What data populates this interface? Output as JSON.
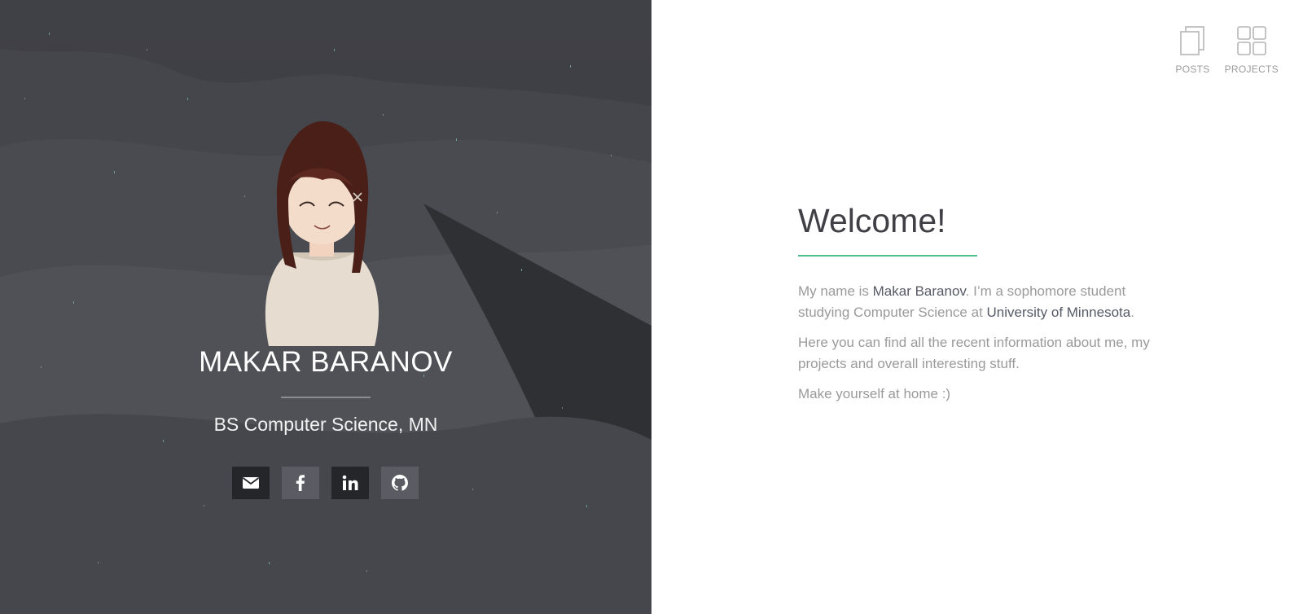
{
  "profile": {
    "name": "MAKAR BARANOV",
    "subtitle": "BS Computer Science, MN",
    "avatar_icon": "avatar-illustration"
  },
  "socials": [
    {
      "name": "email",
      "icon": "envelope-icon"
    },
    {
      "name": "facebook",
      "icon": "facebook-icon"
    },
    {
      "name": "linkedin",
      "icon": "linkedin-icon"
    },
    {
      "name": "github",
      "icon": "github-icon"
    }
  ],
  "nav": {
    "posts_label": "POSTS",
    "projects_label": "PROJECTS"
  },
  "welcome": {
    "title": "Welcome!",
    "p1_before": "My name is ",
    "p1_name": "Makar Baranov",
    "p1_mid": ". I’m a sophomore student studying Computer Science at ",
    "p1_link": "University of Minnesota",
    "p1_after": ".",
    "p2": "Here you can find all the recent information about me, my projects and overall interesting stuff.",
    "p3": "Make yourself at home :)"
  },
  "colors": {
    "accent": "#4fc08d",
    "hero_bg": "#3d3e44",
    "muted_text": "#9a9a9a"
  }
}
